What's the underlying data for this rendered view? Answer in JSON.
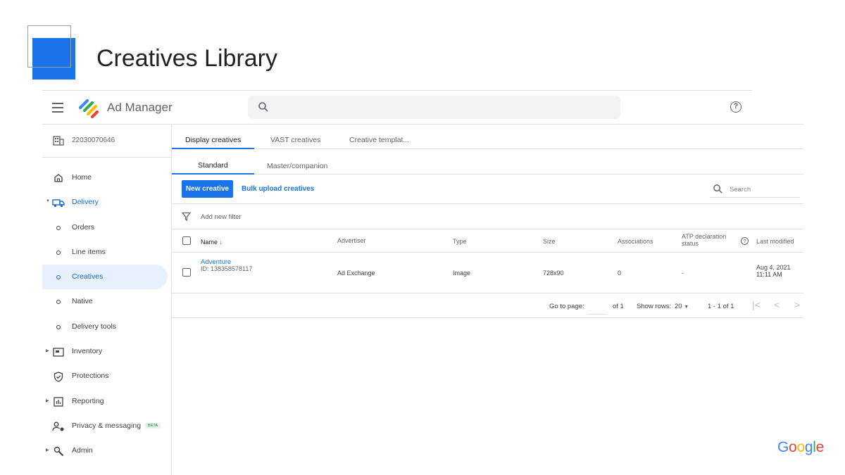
{
  "slide": {
    "title": "Creatives Library",
    "brand_word": [
      "G",
      "o",
      "o",
      "g",
      "l",
      "e"
    ],
    "brand_colors": [
      "#4285F4",
      "#EA4335",
      "#FBBC05",
      "#4285F4",
      "#34A853",
      "#EA4335"
    ]
  },
  "app": {
    "name": "Ad Manager",
    "network_id": "22030070646"
  },
  "sidebar": {
    "items": [
      {
        "label": "Home",
        "icon": "home-icon"
      },
      {
        "label": "Delivery",
        "icon": "truck-icon",
        "expanded": true
      },
      {
        "label": "Orders",
        "icon": "circle-icon"
      },
      {
        "label": "Line items",
        "icon": "circle-icon"
      },
      {
        "label": "Creatives",
        "icon": "circle-icon",
        "active": true
      },
      {
        "label": "Native",
        "icon": "circle-icon"
      },
      {
        "label": "Delivery tools",
        "icon": "circle-icon"
      },
      {
        "label": "Inventory",
        "icon": "inventory-icon"
      },
      {
        "label": "Protections",
        "icon": "shield-icon"
      },
      {
        "label": "Reporting",
        "icon": "bar-chart-icon"
      },
      {
        "label": "Privacy & messaging",
        "icon": "person-lock-icon",
        "badge": "BETA"
      },
      {
        "label": "Admin",
        "icon": "wrench-icon"
      }
    ]
  },
  "tabs": [
    "Display creatives",
    "VAST creatives",
    "Creative templat..."
  ],
  "subtabs": [
    "Standard",
    "Master/companion"
  ],
  "toolbar": {
    "new_creative": "New creative",
    "bulk_upload": "Bulk upload creatives",
    "search_placeholder": "Search"
  },
  "filter": {
    "placeholder": "Add new filter"
  },
  "table": {
    "columns": [
      "Name",
      "Advertiser",
      "Type",
      "Size",
      "Associations",
      "ATP declaration status",
      "Last modified"
    ],
    "rows": [
      {
        "name": "Adventure",
        "id": "ID: 138358578117",
        "advertiser": "Ad Exchange",
        "type": "Image",
        "size": "728x90",
        "associations": "0",
        "atp_status": "-",
        "modified_date": "Aug 4, 2021",
        "modified_time": "11:11 AM"
      }
    ]
  },
  "pagination": {
    "go_to_page": "Go to page:",
    "of_pages": "of 1",
    "show_rows_label": "Show rows:",
    "rows_value": "20",
    "range": "1 - 1 of 1"
  },
  "colors": {
    "accent": "#1a73e8",
    "active_bg": "#e8f0fe"
  }
}
